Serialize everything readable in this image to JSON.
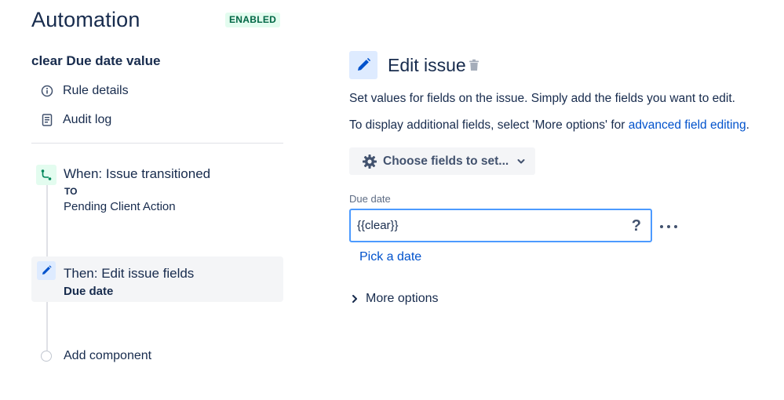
{
  "header": {
    "title": "Automation",
    "status": "ENABLED"
  },
  "sidebar": {
    "rule_name": "clear Due date value",
    "nav": [
      {
        "label": "Rule details",
        "icon": "info-icon"
      },
      {
        "label": "Audit log",
        "icon": "document-icon"
      }
    ],
    "trigger": {
      "title": "When: Issue transitioned",
      "subtitle_small": "TO",
      "subtitle": "Pending Client Action",
      "icon": "branch-icon"
    },
    "action": {
      "title": "Then: Edit issue fields",
      "subtitle": "Due date",
      "icon": "pencil-icon"
    },
    "add_component": "Add component"
  },
  "panel": {
    "title": "Edit issue",
    "description_1": "Set values for fields on the issue. Simply add the fields you want to edit.",
    "description_2_prefix": "To display additional fields, select 'More options' for ",
    "description_2_link": "advanced field editing",
    "description_2_suffix": ".",
    "choose_fields_label": "Choose fields to set...",
    "field": {
      "label": "Due date",
      "value": "{{clear}}",
      "help": "?"
    },
    "pick_date": "Pick a date",
    "more_options": "More options"
  },
  "colors": {
    "accent": "#0052cc",
    "status_bg": "#e3fcef",
    "status_fg": "#006644",
    "focus_border": "#4c9aff"
  }
}
